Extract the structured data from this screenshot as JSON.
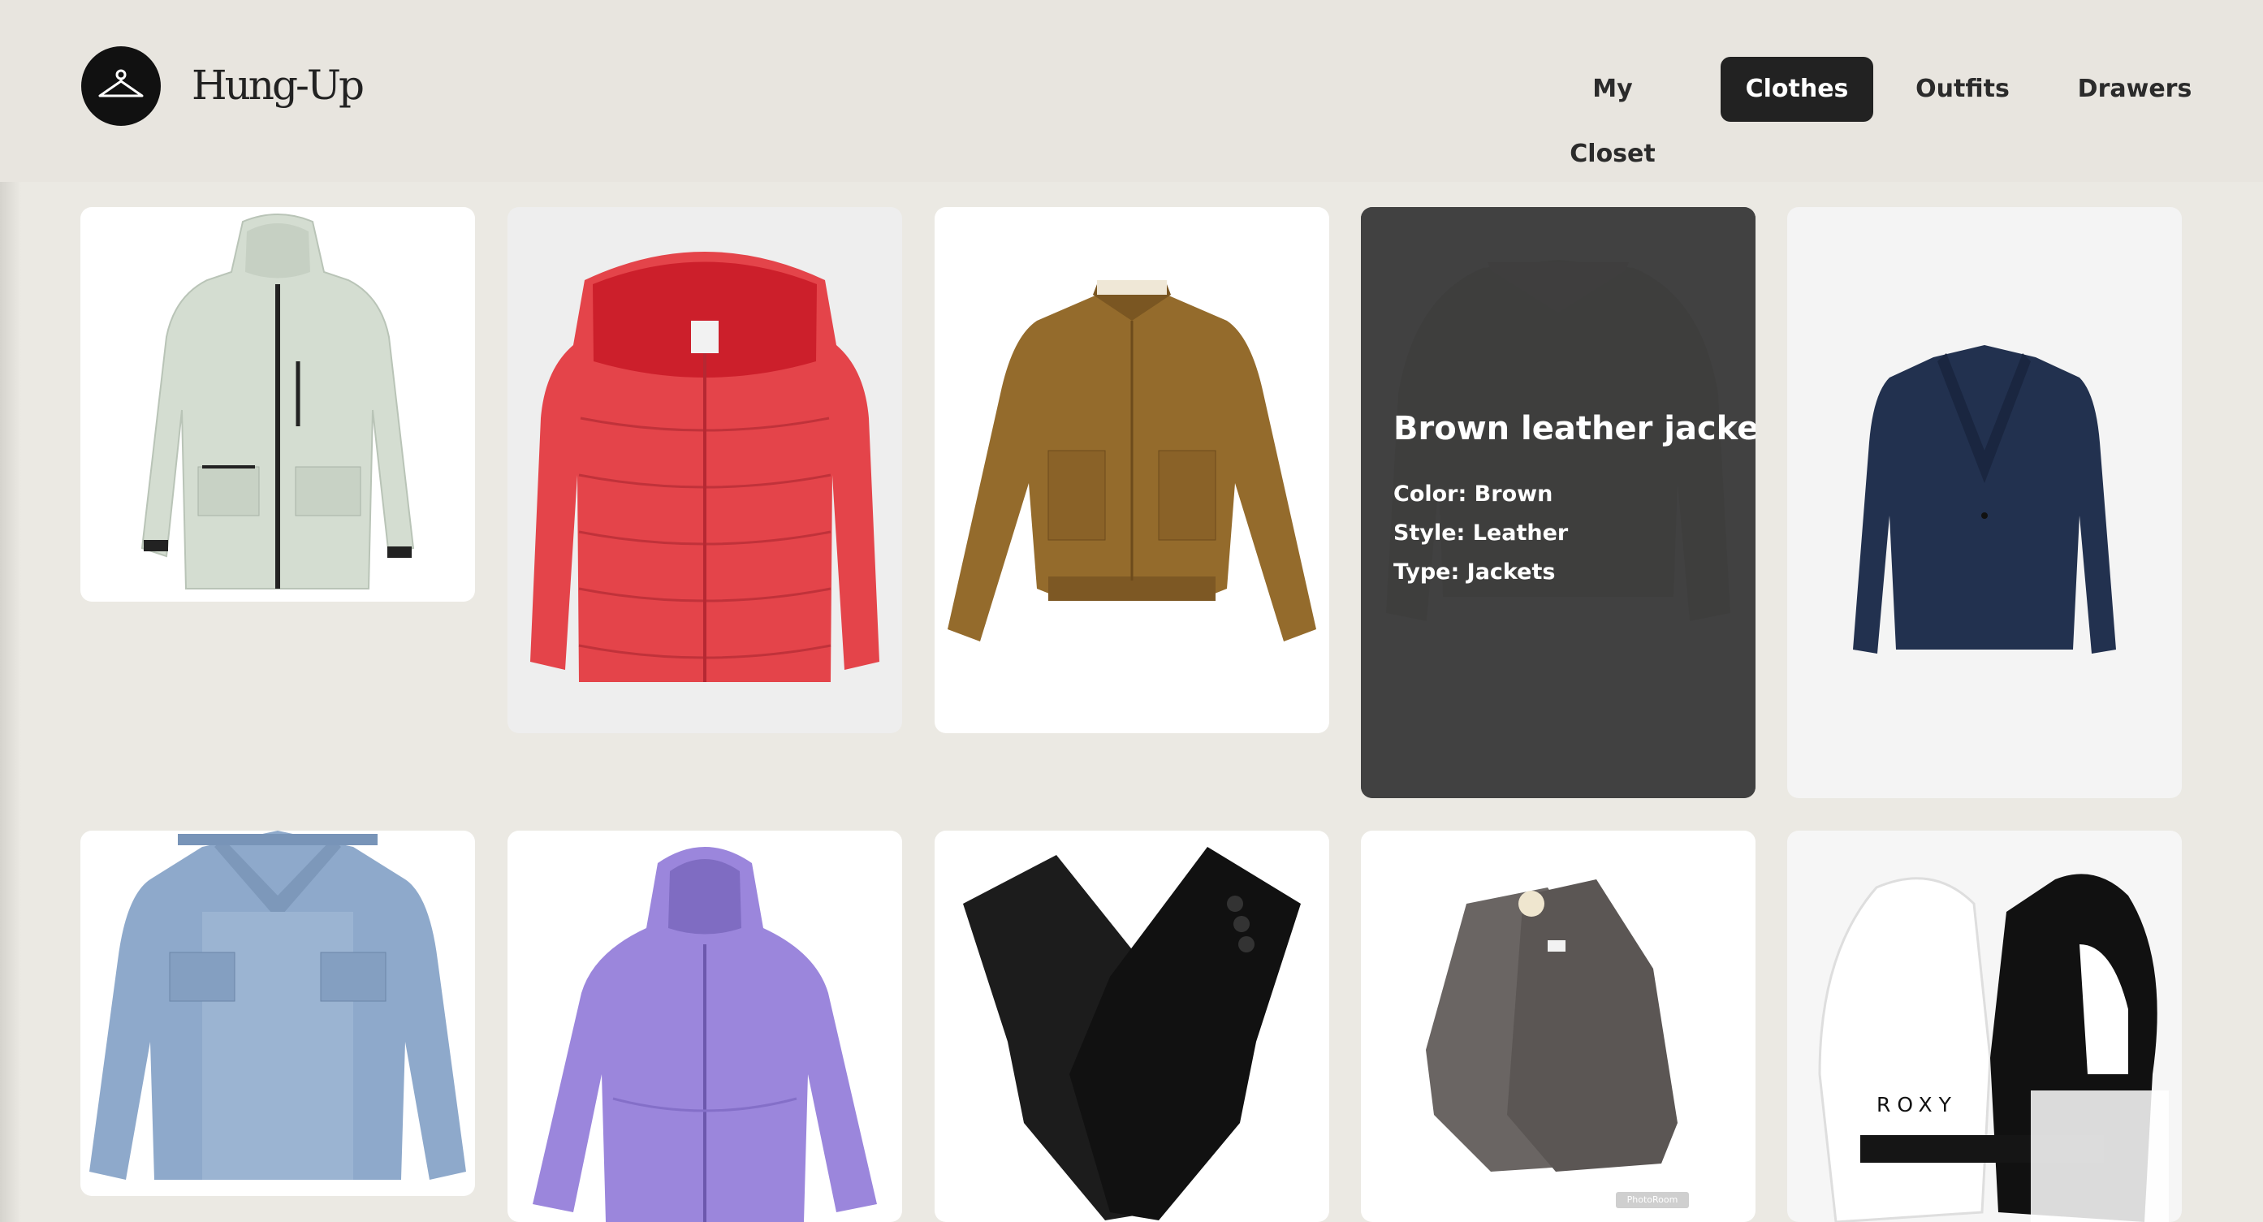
{
  "header": {
    "brand": "Hung-Up",
    "nav": [
      {
        "label": "My Closet",
        "active": false
      },
      {
        "label": "Clothes",
        "active": true
      },
      {
        "label": "Outfits",
        "active": false
      },
      {
        "label": "Drawers",
        "active": false
      }
    ]
  },
  "items": [
    {
      "name": "mint-rain-jacket",
      "icon": "hooded-shell-jacket"
    },
    {
      "name": "red-puffer-jacket",
      "icon": "hooded-puffer-jacket"
    },
    {
      "name": "suede-bomber-jacket",
      "icon": "bomber-jacket"
    },
    {
      "name": "brown-leather-jacket",
      "icon": "leather-jacket",
      "hover": {
        "title": "Brown leather jacket",
        "color": "Color: Brown",
        "style": "Style: Leather",
        "type": "Type: Jackets"
      }
    },
    {
      "name": "navy-blazer",
      "icon": "blazer"
    },
    {
      "name": "denim-jacket",
      "icon": "denim-jacket"
    },
    {
      "name": "lavender-rain-jacket",
      "icon": "hooded-jacket"
    },
    {
      "name": "black-leather-gloves",
      "icon": "gloves"
    },
    {
      "name": "grey-knit-gloves",
      "icon": "knit-gloves",
      "tag": "PhotoRoom"
    },
    {
      "name": "roxy-ski-mittens",
      "icon": "mittens",
      "brand": "ROXY"
    }
  ]
}
